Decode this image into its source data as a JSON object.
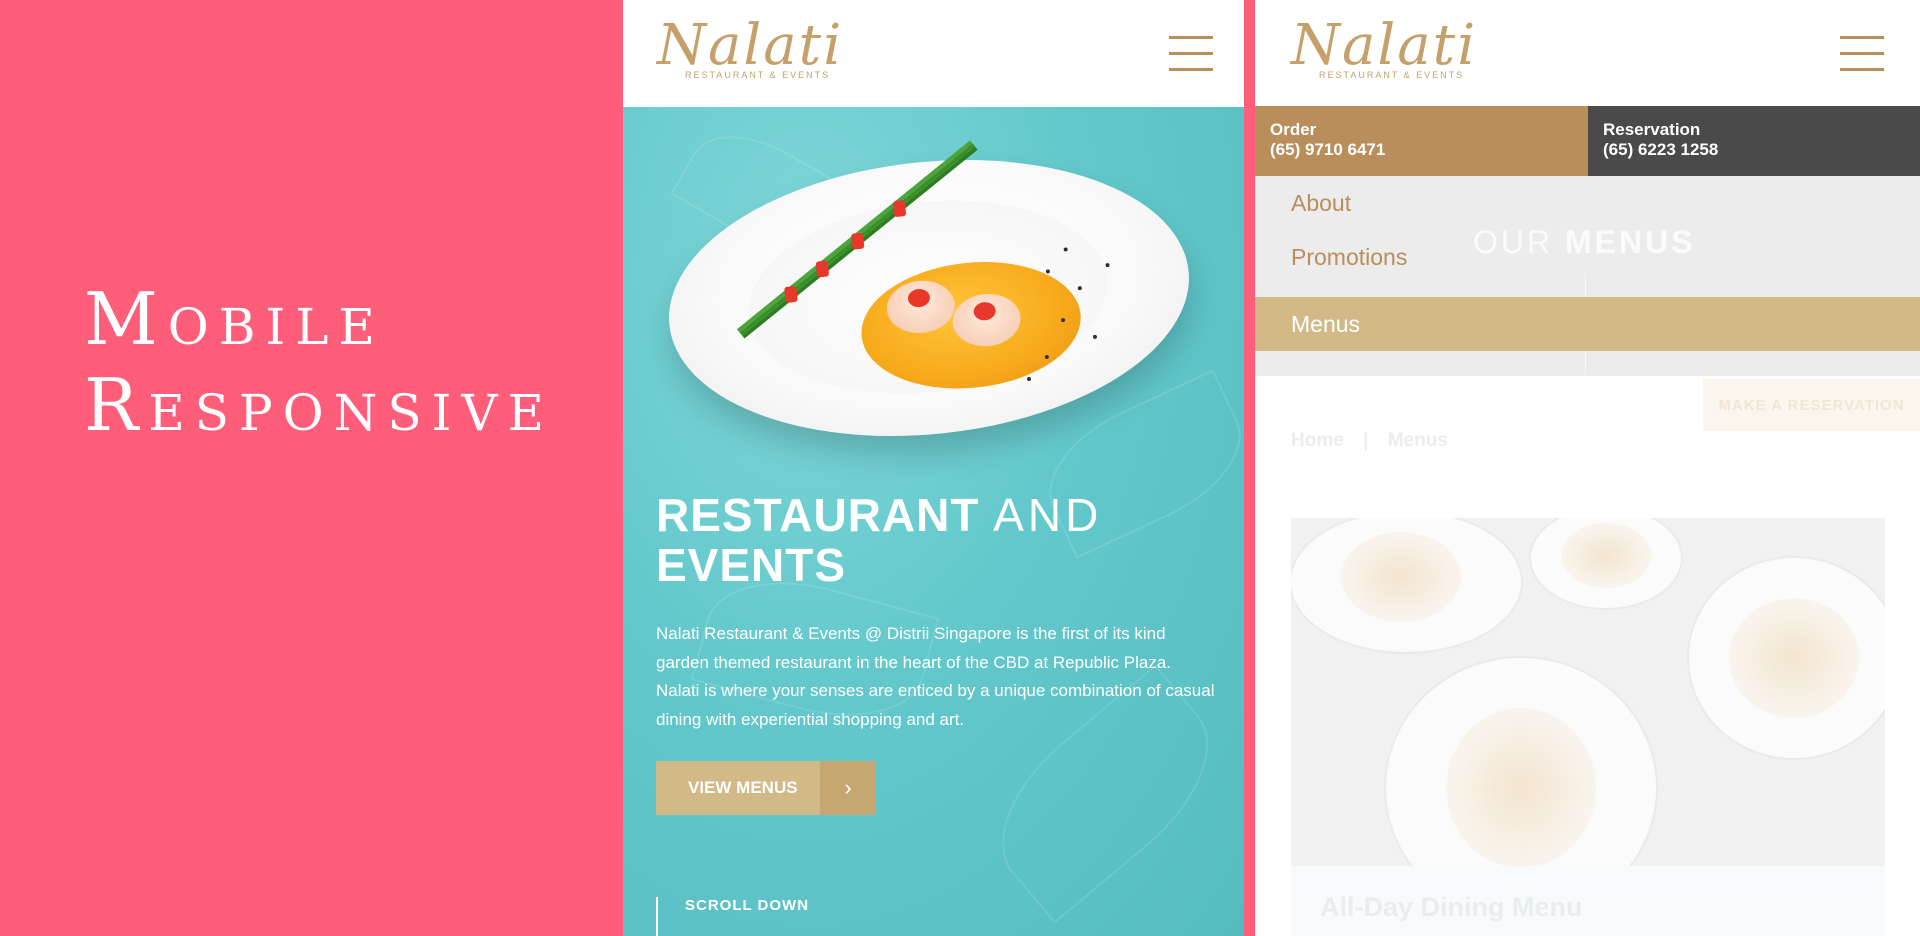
{
  "showcase": {
    "title_line1": "Mobile",
    "title_line2": "Responsive"
  },
  "phone1": {
    "logo": {
      "main": "Nalati",
      "sub": "RESTAURANT & EVENTS"
    },
    "hero": {
      "title_bold1": "RESTAURANT",
      "title_light": "AND",
      "title_bold2": "EVENTS",
      "description": "Nalati Restaurant & Events @ Distrii Singapore is the first of its kind garden themed restaurant in the heart of the CBD at Republic Plaza. Nalati is where your senses are enticed by a unique combination of casual dining with experiential shopping and art.",
      "button_label": "VIEW MENUS",
      "button_arrow": "›",
      "scroll_label": "SCROLL DOWN"
    }
  },
  "phone2": {
    "logo": {
      "main": "Nalati",
      "sub": "RESTAURANT & EVENTS"
    },
    "order": {
      "label": "Order",
      "number": "(65) 9710 6471"
    },
    "reservation": {
      "label": "Reservation",
      "number": "(65) 6223 1258"
    },
    "bg_title": {
      "light": "OUR",
      "bold": "MENUS"
    },
    "nav_items": [
      {
        "label": "About"
      },
      {
        "label": "Promotions"
      },
      {
        "label": "Menus"
      }
    ],
    "reserve_button": "MAKE A RESERVATION",
    "breadcrumb": {
      "home": "Home",
      "sep": "|",
      "current": "Menus"
    },
    "card_caption": "All-Day Dining Menu"
  },
  "colors": {
    "pink_bg": "#ff5e7a",
    "teal": "#5fc9cc",
    "gold": "#b98e5a",
    "gold_light": "#d1b988",
    "dark": "#4a4a4a"
  },
  "icons": [
    "menu-hamburger-icon",
    "chevron-right-icon"
  ]
}
